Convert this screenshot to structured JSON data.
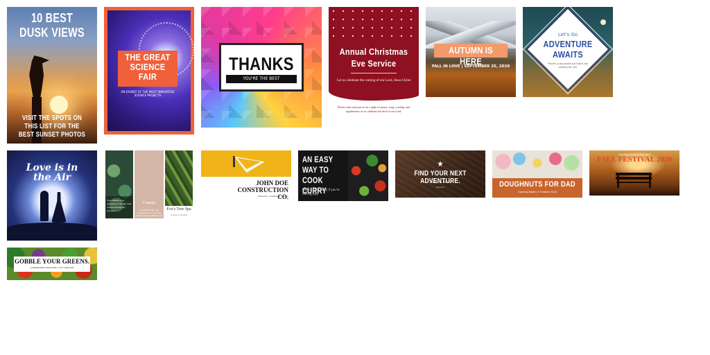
{
  "tiles": {
    "dusk": {
      "title": "10 BEST DUSK VIEWS",
      "subtitle": "VISIT THE SPOTS ON THIS LIST FOR THE BEST SUNSET PHOTOS"
    },
    "science": {
      "title": "THE GREAT SCIENCE FAIR",
      "subtitle": "AN EXHIBIT OF THE MOST INNOVATIVE SCIENCE PROJECTS"
    },
    "thanks": {
      "title": "THANKS",
      "subtitle": "YOU'RE THE BEST"
    },
    "christmas": {
      "title": "Annual Christmas Eve Service",
      "subtitle": "Let us celebrate the coming of our Lord, Jesus Christ",
      "footer": "Please come and join us for a night of prayer, song, worship, and togetherness as we celebrate the birth of our Lord."
    },
    "autumn": {
      "title": "AUTUMN IS HERE",
      "subtitle": "FALL IN LOVE | SEPTEMBER 25, 2020"
    },
    "adventure": {
      "pretitle": "Let's Go",
      "title": "ADVENTURE AWAITS",
      "subtitle": "There's a big world out there just waiting for you"
    },
    "love": {
      "title": "Love is in the Air"
    },
    "spa": {
      "overlay": "Your hidden go-to sanctuary in the city with award-winning spa services",
      "contact_title": "Contact",
      "contact_info": "123-456-7890 123 Anywhere St., Any City hello@reallygreatsite.com",
      "name": "Eve's Tree Spa",
      "tagline": "A haven of paradise"
    },
    "construction": {
      "title": "JOHN DOE CONSTRUCTION CO.",
      "subtitle": "Industrial, Commercial, Private"
    },
    "curry": {
      "title": "AN EASY WAY TO COOK CURRY",
      "subtitle": "How to cook curry if you're feeling lazy"
    },
    "next": {
      "title": "FIND YOUR NEXT ADVENTURE.",
      "subtitle": "Travel & Tours",
      "subtitle2": "Explorer"
    },
    "doughnuts": {
      "title": "DOUGHNUTS FOR DAD",
      "subtitle": "Opening Night | 5 October 2020"
    },
    "fall": {
      "pretitle": "Evening event at the park",
      "title": "FALL FESTIVAL 2020"
    },
    "greens": {
      "title": "GOBBLE YOUR GREENS.",
      "subtitle": "A REMINDER FROM BIG CITY GROCER"
    }
  }
}
